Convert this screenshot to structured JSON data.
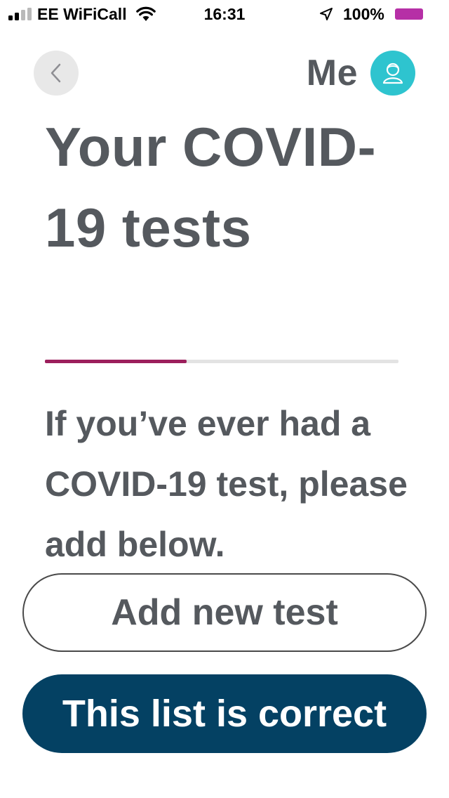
{
  "status_bar": {
    "carrier": "EE WiFiCall",
    "time": "16:31",
    "battery_percent": "100%",
    "battery_color": "#b62fa6",
    "signal_bars_active": 2,
    "signal_bars_total": 4
  },
  "header": {
    "back_icon": "chevron-left-icon",
    "profile_label": "Me",
    "avatar_icon": "user-avatar-icon",
    "avatar_color": "#2ec4cf"
  },
  "main": {
    "title": "Your COVID-19 tests",
    "progress_fraction": 0.4,
    "progress_color": "#9c1f5c",
    "description": "If you’ve ever had a COVID-19 test, please add below."
  },
  "actions": {
    "add_label": "Add new test",
    "confirm_label": "This list is correct",
    "confirm_color": "#044163"
  }
}
